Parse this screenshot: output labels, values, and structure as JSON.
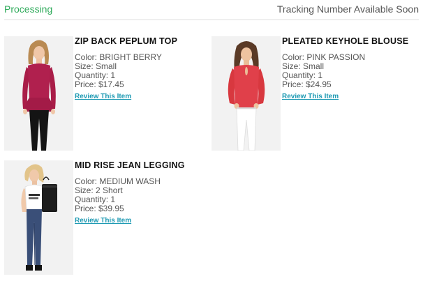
{
  "order": {
    "status": "Processing",
    "tracking_note": "Tracking Number Available Soon"
  },
  "items": [
    {
      "name": "ZIP BACK PEPLUM TOP",
      "color": "Color: BRIGHT BERRY",
      "size": "Size: Small",
      "quantity": "Quantity: 1",
      "price": "Price: $17.45",
      "review_label": "Review This Item",
      "swatch": "#b0204e"
    },
    {
      "name": "PLEATED KEYHOLE BLOUSE",
      "color": "Color: PINK PASSION",
      "size": "Size: Small",
      "quantity": "Quantity: 1",
      "price": "Price: $24.95",
      "review_label": "Review This Item",
      "swatch": "#e0404a"
    },
    {
      "name": "MID RISE JEAN LEGGING",
      "color": "Color: MEDIUM WASH",
      "size": "Size: 2 Short",
      "quantity": "Quantity: 1",
      "price": "Price: $39.95",
      "review_label": "Review This Item",
      "swatch": "#3a4f78"
    }
  ],
  "theme": {
    "status_color": "#2eaa5a",
    "link_color": "#1e9ab3"
  }
}
